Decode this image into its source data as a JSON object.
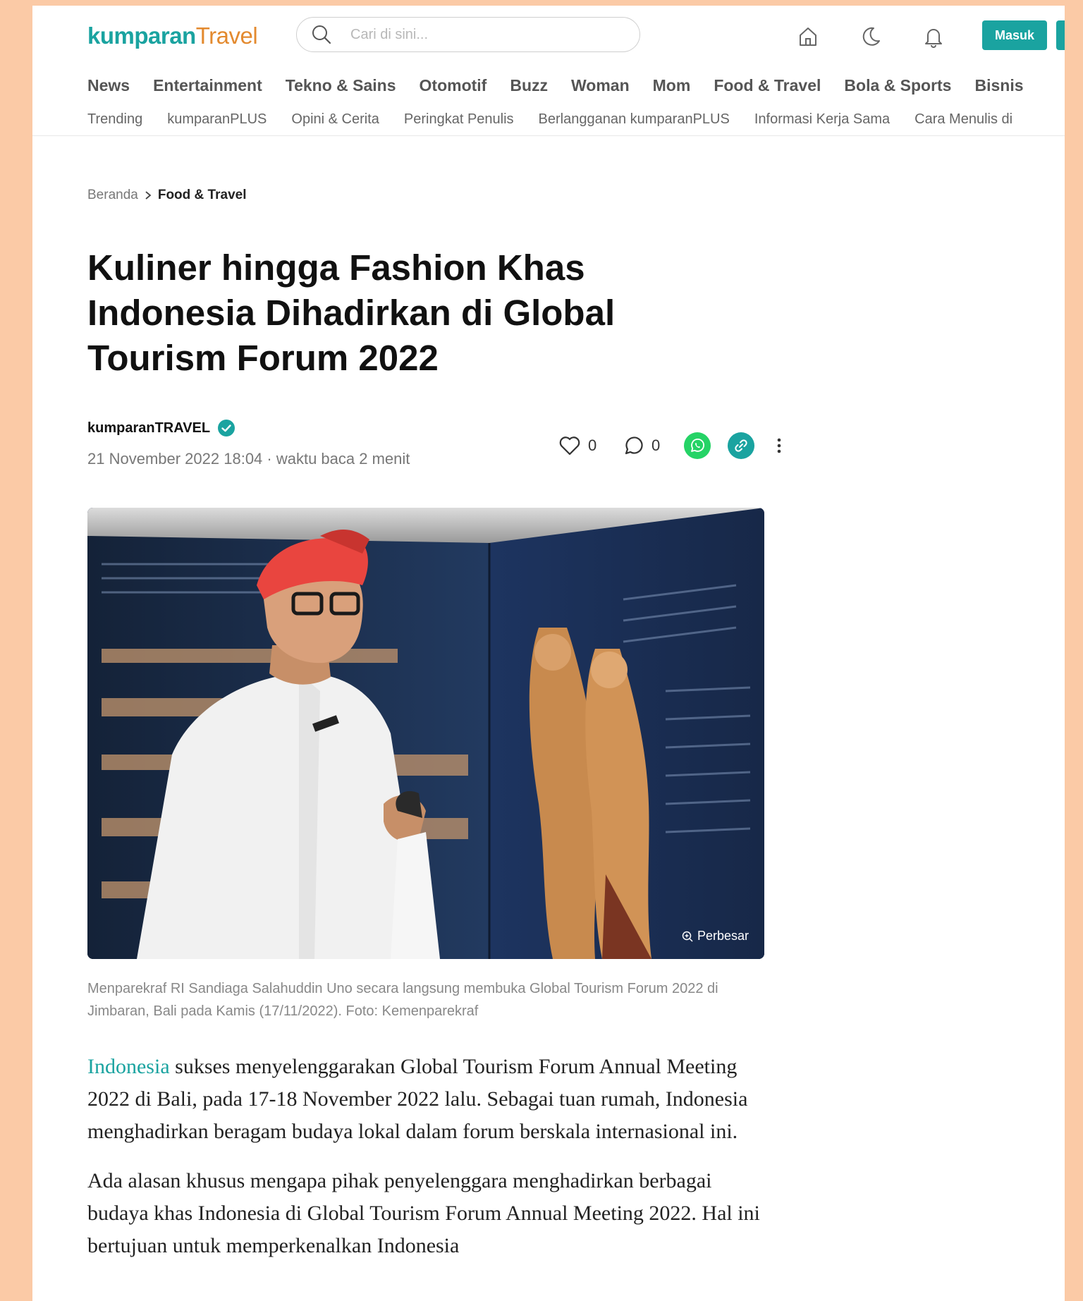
{
  "header": {
    "logo_part1": "kumparan",
    "logo_part2": "Travel",
    "search_placeholder": "Cari di sini...",
    "login_label": "Masuk",
    "nav": [
      "News",
      "Entertainment",
      "Tekno & Sains",
      "Otomotif",
      "Buzz",
      "Woman",
      "Mom",
      "Food & Travel",
      "Bola & Sports",
      "Bisnis"
    ],
    "subnav": [
      "Trending",
      "kumparanPLUS",
      "Opini & Cerita",
      "Peringkat Penulis",
      "Berlangganan kumparanPLUS",
      "Informasi Kerja Sama",
      "Cara Menulis di"
    ]
  },
  "breadcrumb": {
    "home": "Beranda",
    "current": "Food & Travel"
  },
  "article": {
    "title": "Kuliner hingga Fashion Khas Indonesia Dihadirkan di Global Tourism Forum 2022",
    "author": "kumparanTRAVEL",
    "meta": "21 November 2022 18:04 · waktu baca 2 menit",
    "likes": "0",
    "comments": "0",
    "enlarge_label": "Perbesar",
    "caption": "Menparekraf RI Sandiaga Salahuddin Uno secara langsung membuka Global Tourism Forum 2022 di Jimbaran, Bali pada Kamis (17/11/2022). Foto: Kemenparekraf",
    "p1_link": "Indonesia",
    "p1_rest": " sukses menyelenggarakan Global Tourism Forum Annual Meeting 2022 di Bali, pada 17-18 November 2022 lalu. Sebagai tuan rumah, Indonesia menghadirkan beragam budaya lokal dalam forum berskala internasional ini.",
    "p2": "Ada alasan khusus mengapa pihak penyelenggara menghadirkan berbagai budaya khas Indonesia di Global Tourism Forum Annual Meeting 2022. Hal ini bertujuan untuk memperkenalkan Indonesia"
  },
  "colors": {
    "accent": "#1aa3a0",
    "logo_orange": "#e38a2f",
    "whatsapp": "#25d366",
    "background": "#fbcaa6"
  }
}
